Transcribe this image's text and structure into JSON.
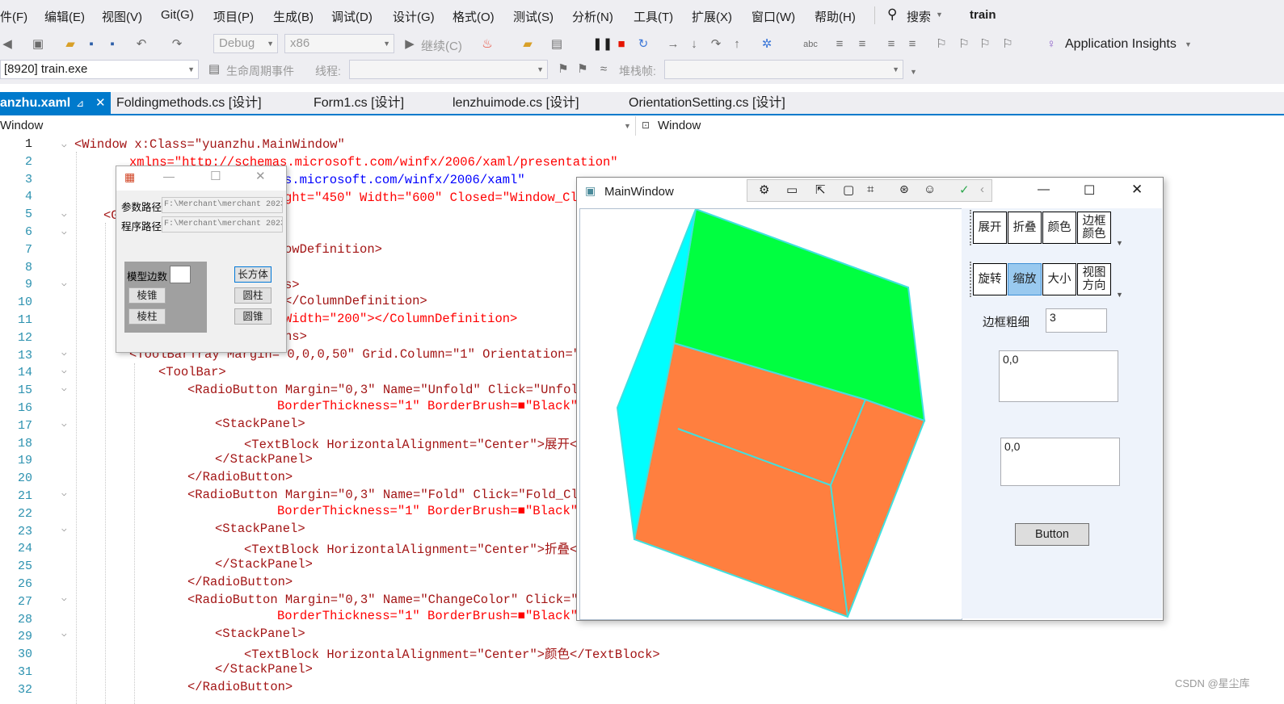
{
  "menubar": {
    "items": [
      "件(F)",
      "编辑(E)",
      "视图(V)",
      "Git(G)",
      "项目(P)",
      "生成(B)",
      "调试(D)",
      "设计(G)",
      "格式(O)",
      "测试(S)",
      "分析(N)",
      "工具(T)",
      "扩展(X)",
      "窗口(W)",
      "帮助(H)"
    ],
    "search_label": "搜索",
    "solution_name": "train"
  },
  "toolbar": {
    "config": "Debug",
    "platform": "x86",
    "continue_label": "继续(C)",
    "insights_label": "Application Insights"
  },
  "toolbar2": {
    "process": "[8920] train.exe",
    "lifecycle_label": "生命周期事件",
    "thread_label": "线程:",
    "stackframe_label": "堆栈帧:"
  },
  "tabs": [
    {
      "label": "anzhu.xaml",
      "active": true
    },
    {
      "label": "Foldingmethods.cs [设计]",
      "active": false
    },
    {
      "label": "Form1.cs [设计]",
      "active": false
    },
    {
      "label": "lenzhuimode.cs [设计]",
      "active": false
    },
    {
      "label": "OrientationSetting.cs [设计]",
      "active": false
    }
  ],
  "nav": {
    "left": "Window",
    "right": "Window"
  },
  "line_numbers": [
    "1",
    "2",
    "3",
    "4",
    "5",
    "6",
    "7",
    "8",
    "9",
    "10",
    "11",
    "12",
    "13",
    "14",
    "15",
    "16",
    "17",
    "18",
    "19",
    "20",
    "21",
    "22",
    "23",
    "24",
    "25",
    "26",
    "27",
    "28",
    "29",
    "30",
    "31",
    "32"
  ],
  "code": {
    "l1": "<Window x:Class=\"yuanzhu.MainWindow\"",
    "l2": "xmlns=\"http://schemas.microsoft.com/winfx/2006/xaml/presentation\"",
    "l3": "s.microsoft.com/winfx/2006/xaml\"",
    "l4": "ght=\"450\" Width=\"600\" Closed=\"Window_Clos",
    "l5": "<G",
    "l7": "owDefinition>",
    "l9": "s>",
    "l10": "</ColumnDefinition>",
    "l11": "Width=\"200\"></ColumnDefinition>",
    "l12": "ns>",
    "l13": "<ToolBarTray Margin=\"0,0,0,50\" Grid.Column=\"1\" Orientation=\"Hor",
    "l14": "<ToolBar>",
    "l15": "<RadioButton Margin=\"0,3\" Name=\"Unfold\" Click=\"Unfold_Cl",
    "l16": "BorderThickness=\"1\" BorderBrush=■\"Black\">",
    "l17": "<StackPanel>",
    "l18": "<TextBlock HorizontalAlignment=\"Center\">展开</Te",
    "l19": "</StackPanel>",
    "l20": "</RadioButton>",
    "l21": "<RadioButton Margin=\"0,3\" Name=\"Fold\" Click=\"Fold_Click\"",
    "l22": "BorderThickness=\"1\" BorderBrush=■\"Black\">",
    "l23": "<StackPanel>",
    "l24": "<TextBlock HorizontalAlignment=\"Center\">折叠</Te",
    "l25": "</StackPanel>",
    "l26": "</RadioButton>",
    "l27": "<RadioButton Margin=\"0,3\" Name=\"ChangeColor\" Click=\"Chan",
    "l28": "BorderThickness=\"1\" BorderBrush=■\"Black\">",
    "l29": "<StackPanel>",
    "l30": "<TextBlock HorizontalAlignment=\"Center\">颜色</TextBlock>",
    "l31": "</StackPanel>",
    "l32": "</RadioButton>"
  },
  "form1": {
    "param_label": "参数路径",
    "param_value": "F:\\Merchant\\merchant 2023",
    "program_label": "程序路径",
    "program_value": "F:\\Merchant\\merchant 2023",
    "model_edges_label": "模型边数",
    "btn_cone": "棱锥",
    "btn_prism": "棱柱",
    "btn_cuboid": "长方体",
    "btn_cylinder": "圆柱",
    "btn_circcone": "圆锥"
  },
  "mainwindow": {
    "title": "MainWindow",
    "toolbar1": [
      "展开",
      "折叠",
      "颜色",
      "边框颜色"
    ],
    "toolbar2": [
      "旋转",
      "缩放",
      "大小",
      "视图方向"
    ],
    "selected_tool": "缩放",
    "border_label": "边框粗细",
    "border_value": "3",
    "text1": "0,0",
    "text2": "0,0",
    "button_label": "Button",
    "colors": {
      "top": "#00ff40",
      "left": "#00ffff",
      "front": "#ff7f3f",
      "edge": "#40e0e0"
    }
  },
  "watermark": "CSDN @星尘库"
}
